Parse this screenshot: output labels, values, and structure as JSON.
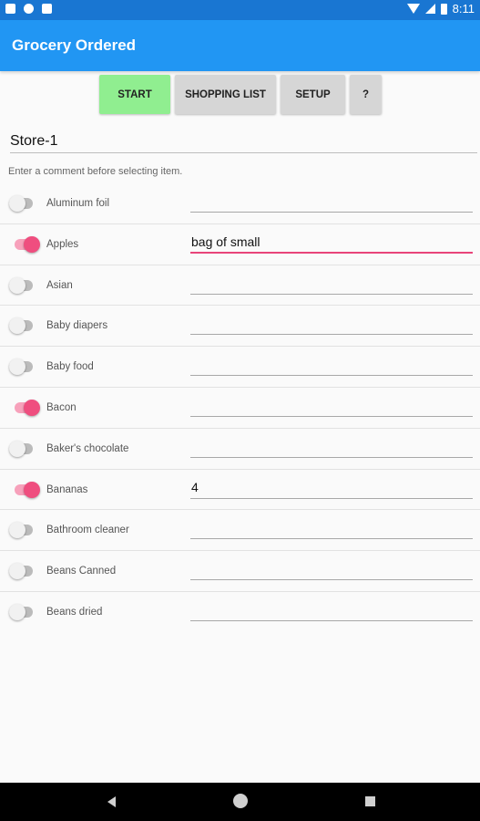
{
  "status_bar": {
    "time": "8:11",
    "icons": [
      "notification-icon",
      "sync-icon",
      "sd-card-icon",
      "wifi-icon",
      "signal-icon",
      "battery-icon"
    ]
  },
  "app_bar": {
    "title": "Grocery Ordered",
    "color": "#2196f3"
  },
  "toolbar": {
    "start_label": "START",
    "shopping_list_label": "SHOPPING LIST",
    "setup_label": "SETUP",
    "help_label": "?"
  },
  "store": {
    "value": "Store-1"
  },
  "hint": "Enter a comment before selecting item.",
  "items": [
    {
      "label": "Aluminum foil",
      "selected": false,
      "comment": ""
    },
    {
      "label": "Apples",
      "selected": true,
      "comment": "bag of small"
    },
    {
      "label": "Asian",
      "selected": false,
      "comment": ""
    },
    {
      "label": "Baby diapers",
      "selected": false,
      "comment": ""
    },
    {
      "label": "Baby food",
      "selected": false,
      "comment": ""
    },
    {
      "label": "Bacon",
      "selected": true,
      "comment": ""
    },
    {
      "label": "Baker's chocolate",
      "selected": false,
      "comment": ""
    },
    {
      "label": "Bananas",
      "selected": true,
      "comment": "4"
    },
    {
      "label": "Bathroom cleaner",
      "selected": false,
      "comment": ""
    },
    {
      "label": "Beans Canned",
      "selected": false,
      "comment": ""
    },
    {
      "label": "Beans dried",
      "selected": false,
      "comment": ""
    }
  ],
  "colors": {
    "accent": "#ef4e7f",
    "start_button": "#90ee90",
    "button": "#d6d6d6"
  }
}
